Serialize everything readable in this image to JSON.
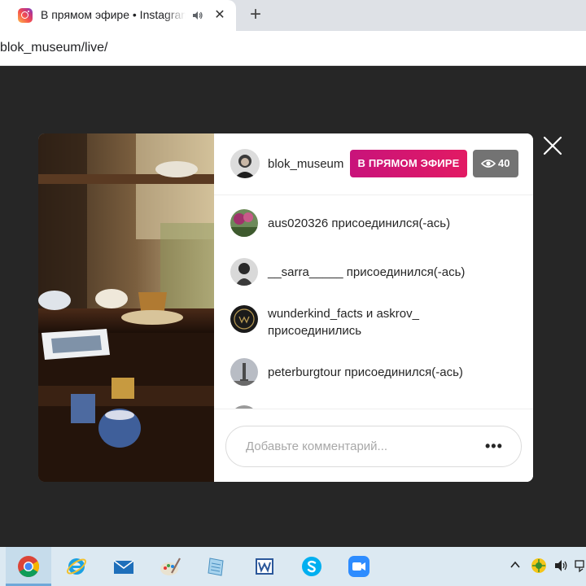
{
  "browser": {
    "tab_title": "В прямом эфире • Instagram",
    "close_tab": "✕",
    "new_tab": "+",
    "url": "blok_museum/live/"
  },
  "live": {
    "username": "blok_museum",
    "live_label": "В ПРЯМОМ ЭФИРЕ",
    "viewer_count": "40",
    "events": [
      {
        "text": "aus020326 присоединился(-ась)"
      },
      {
        "text": "__sarra_____ присоединился(-ась)"
      },
      {
        "text": "wunderkind_facts и askrov_ присоединились"
      },
      {
        "text": "peterburgtour присоединился(-ась)"
      }
    ],
    "comment_placeholder": "Добавьте комментарий...",
    "more_label": "•••"
  },
  "taskbar": {
    "apps": [
      "chrome-icon",
      "internet-explorer-icon",
      "mail-icon",
      "paint-icon",
      "notepad-icon",
      "word-icon",
      "skype-icon",
      "zoom-icon"
    ],
    "tray": [
      "show-hidden-icons-chevron",
      "network-icon",
      "volume-icon",
      "keyboard-icon"
    ]
  },
  "colors": {
    "live_badge": "#d3176f",
    "viewer_badge": "#737373",
    "backdrop": "#262626"
  }
}
